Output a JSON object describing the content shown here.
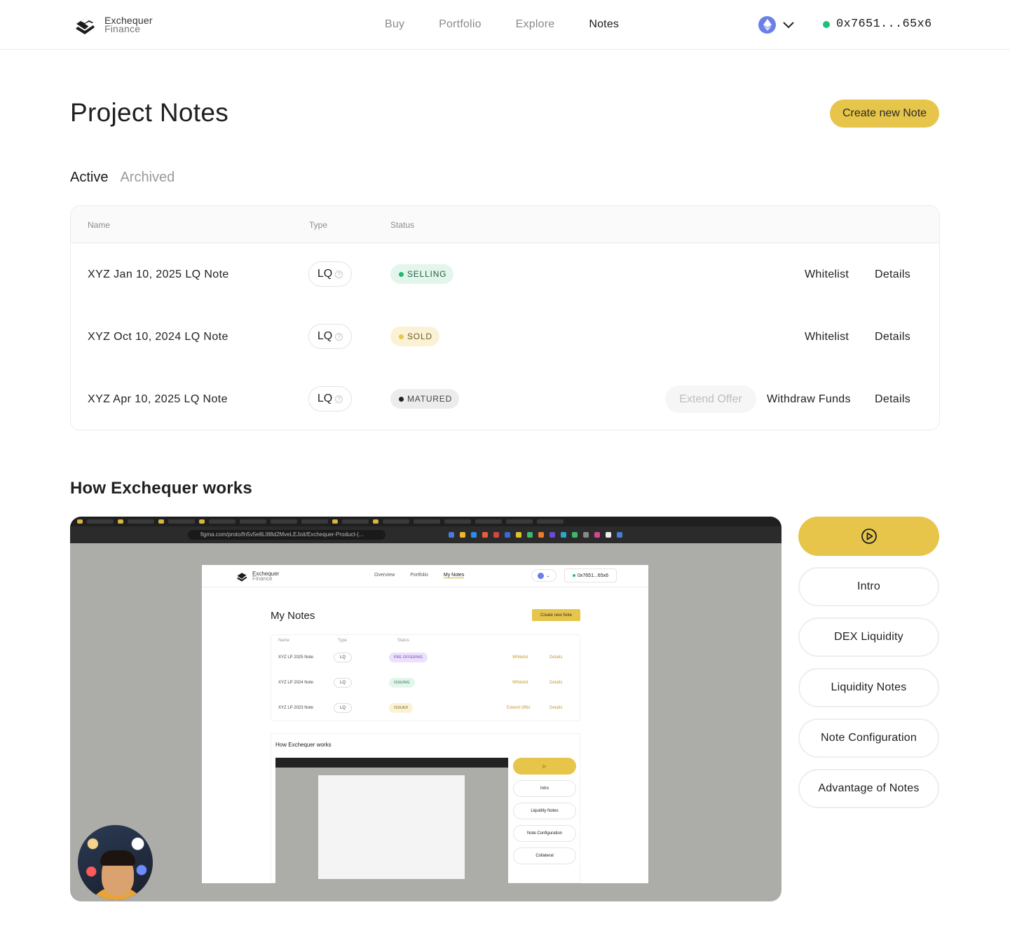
{
  "brand": {
    "line1": "Exchequer",
    "line2": "Finance"
  },
  "nav": {
    "items": [
      {
        "label": "Buy",
        "active": false
      },
      {
        "label": "Portfolio",
        "active": false
      },
      {
        "label": "Explore",
        "active": false
      },
      {
        "label": "Notes",
        "active": true
      }
    ]
  },
  "chain": {
    "icon": "ethereum-icon"
  },
  "wallet": {
    "address": "0x7651...65x6",
    "status_color": "#1dbf79"
  },
  "page": {
    "title": "Project Notes",
    "create_label": "Create new Note"
  },
  "tabs": [
    {
      "label": "Active",
      "active": true
    },
    {
      "label": "Archived",
      "active": false
    }
  ],
  "table": {
    "headers": {
      "name": "Name",
      "type": "Type",
      "status": "Status"
    },
    "rows": [
      {
        "name": "XYZ Jan 10, 2025 LQ Note",
        "type": "LQ",
        "status": "SELLING",
        "actions": [
          "Whitelist",
          "Details"
        ]
      },
      {
        "name": "XYZ Oct 10, 2024 LQ Note",
        "type": "LQ",
        "status": "SOLD",
        "actions": [
          "Whitelist",
          "Details"
        ]
      },
      {
        "name": "XYZ Apr 10, 2025 LQ Note",
        "type": "LQ",
        "status": "MATURED",
        "disabled_action": "Extend Offer",
        "actions": [
          "Withdraw Funds",
          "Details"
        ]
      }
    ]
  },
  "how": {
    "title": "How Exchequer works",
    "video": {
      "url": "figma.com/proto/fn5v5e8LI88d2MveLEJoit/Exchequer-Product-(...",
      "inner": {
        "brand1": "Exchequer",
        "brand2": "Finance",
        "nav": [
          "Overview",
          "Portfolio",
          "My Notes"
        ],
        "wallet": "0x7651...65x6",
        "title": "My Notes",
        "create": "Create new Note",
        "headers": [
          "Name",
          "Type",
          "Status"
        ],
        "rows": [
          {
            "name": "XYZ LP 2025 Note",
            "type": "LQ",
            "status": "PRE OFFERING",
            "a1": "Whitelist",
            "a2": "Details"
          },
          {
            "name": "XYZ LP 2024 Note",
            "type": "LQ",
            "status": "ISSUING",
            "a1": "Whitelist",
            "a2": "Details"
          },
          {
            "name": "XYZ LP 2023 Note",
            "type": "LQ",
            "status": "ISSUED",
            "a1": "Extend Offer",
            "a2": "Details"
          }
        ],
        "how_title": "How Exchequer works",
        "chapters": [
          "Intro",
          "Liquidity Notes",
          "Note Configuration",
          "Collateral"
        ]
      }
    },
    "chapters": [
      "Intro",
      "DEX Liquidity",
      "Liquidity Notes",
      "Note Configuration",
      "Advantage of Notes"
    ]
  },
  "colors": {
    "accent": "#e6c54a",
    "selling": "#22b86f",
    "sold": "#e6c54a",
    "matured": "#222222"
  }
}
